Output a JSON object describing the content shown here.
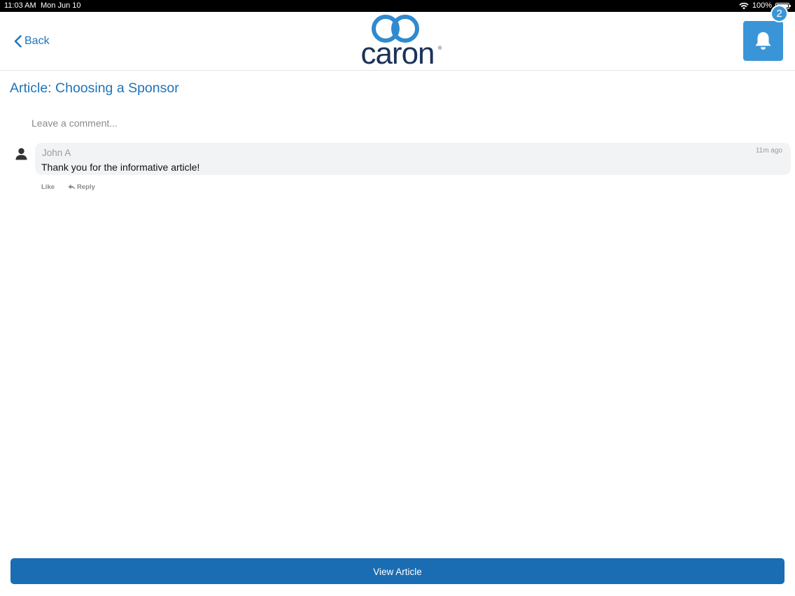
{
  "status_bar": {
    "time": "11:03 AM",
    "date": "Mon Jun 10",
    "battery": "100%",
    "icons": [
      "wifi-icon",
      "battery-icon"
    ]
  },
  "header": {
    "back_label": "Back",
    "logo_text": "caron",
    "logo_reg": "®",
    "notification_count": "2",
    "icons": [
      "chevron-left-icon",
      "bell-icon"
    ]
  },
  "article": {
    "title": "Article: Choosing a Sponsor"
  },
  "comment_box": {
    "placeholder": "Leave a comment..."
  },
  "comments": [
    {
      "author": "John A",
      "text": "Thank you for the informative article!",
      "time": "11m ago",
      "like_label": "Like",
      "reply_label": "Reply"
    }
  ],
  "footer": {
    "view_article_label": "View Article"
  },
  "colors": {
    "accent": "#1f73b8",
    "notification_bg": "#3a95d8",
    "button_bg": "#1a6db3",
    "logo_navy": "#1b3358"
  }
}
